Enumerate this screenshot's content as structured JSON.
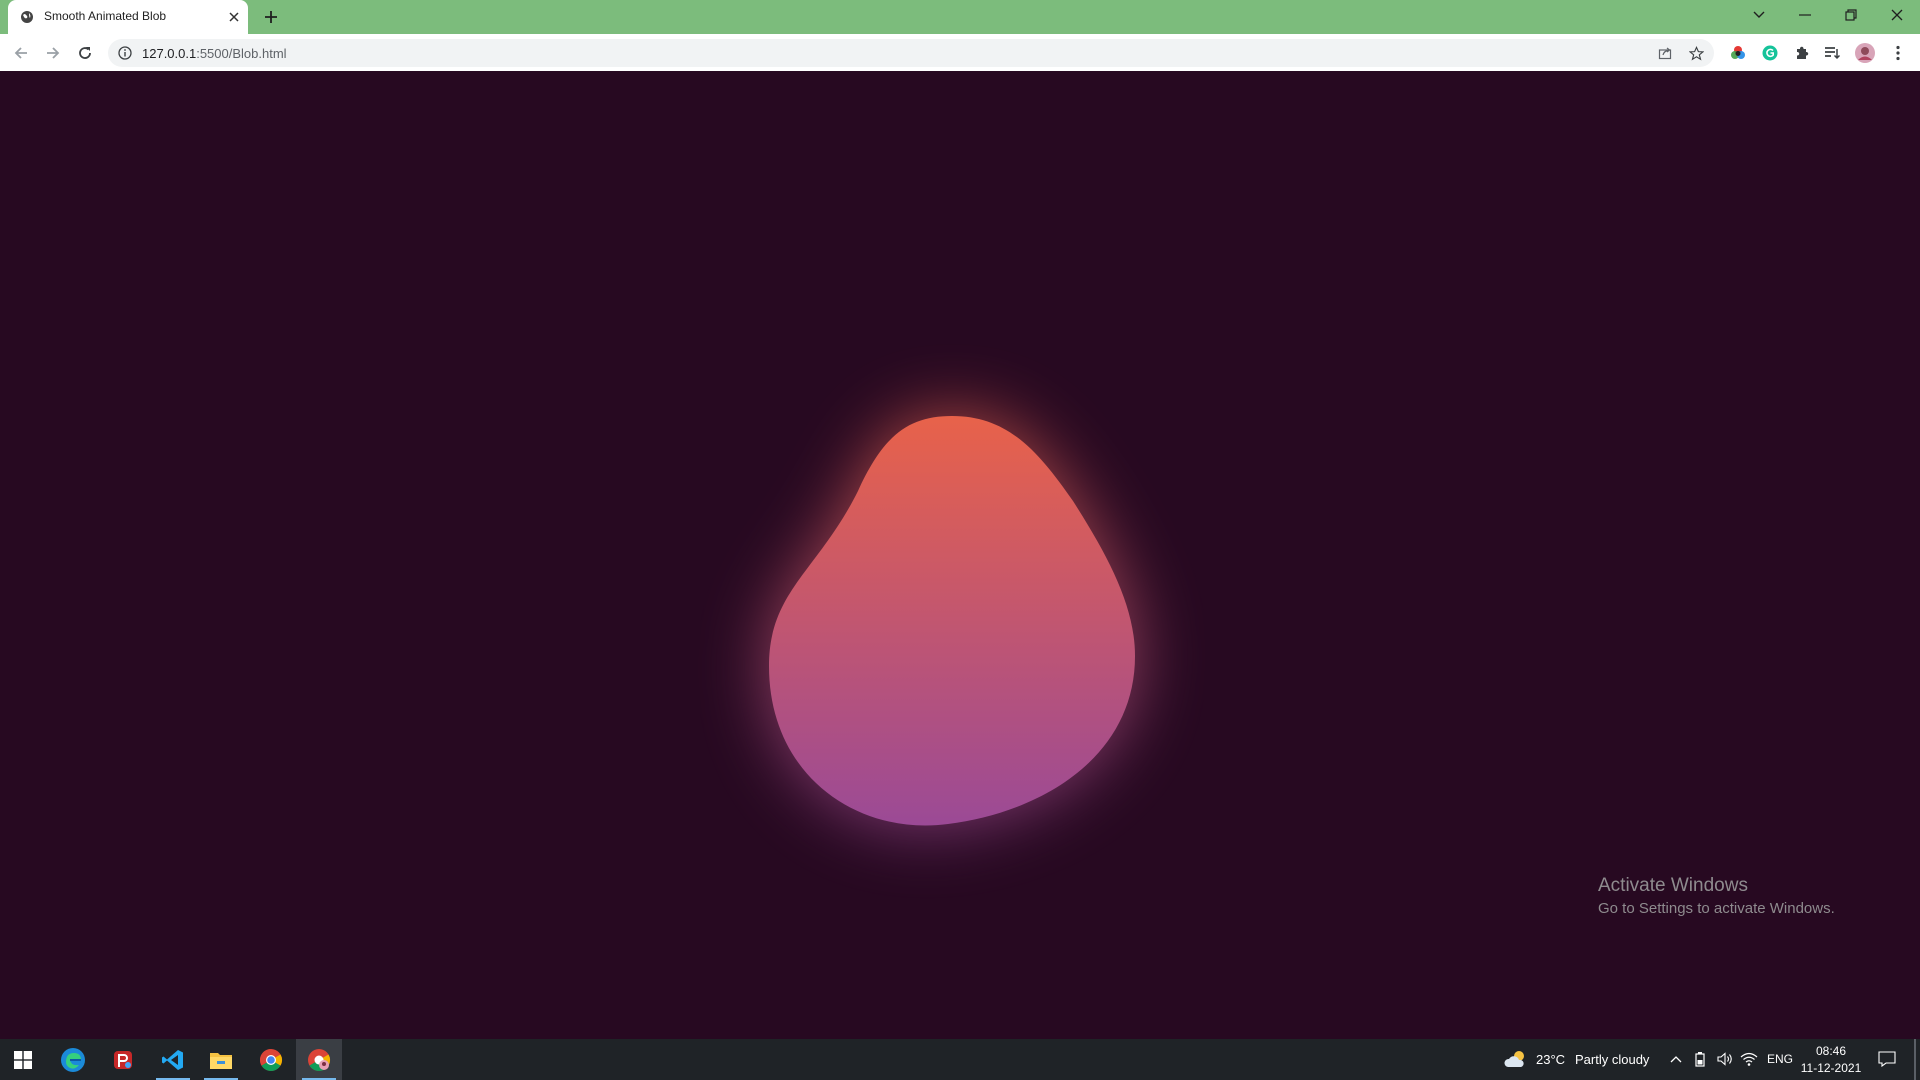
{
  "browser": {
    "tab": {
      "title": "Smooth Animated Blob",
      "favicon": "globe-icon",
      "close_icon": "close-icon"
    },
    "new_tab_icon": "plus-icon",
    "window_controls": [
      "chevron-down-icon",
      "minimize-icon",
      "restore-icon",
      "close-icon"
    ],
    "nav": {
      "back": "back-arrow-icon",
      "forward": "forward-arrow-icon",
      "reload": "reload-icon"
    },
    "address": {
      "info_icon": "info-icon",
      "host": "127.0.0.1",
      "path": ":5500/Blob.html"
    },
    "omnibox_icons": [
      "share-icon",
      "star-icon"
    ],
    "extensions": [
      "color-extension-icon",
      "grammarly-icon",
      "puzzle-icon",
      "reading-list-icon",
      "profile-avatar",
      "kebab-menu-icon"
    ]
  },
  "page": {
    "background_color": "#270921",
    "blob_gradient": [
      "#e8624a",
      "#9b4a96"
    ]
  },
  "watermark": {
    "title": "Activate Windows",
    "subtitle": "Go to Settings to activate Windows."
  },
  "taskbar": {
    "apps": [
      "windows-start-icon",
      "edge-icon",
      "app-icon",
      "vscode-icon",
      "file-explorer-icon",
      "chrome-icon",
      "chrome-profile-icon"
    ],
    "weather": {
      "temp": "23°C",
      "condition": "Partly cloudy"
    },
    "tray": [
      "chevron-up-icon",
      "battery-icon",
      "volume-icon",
      "wifi-icon"
    ],
    "language": "ENG",
    "time": "08:46",
    "date": "11-12-2021"
  }
}
